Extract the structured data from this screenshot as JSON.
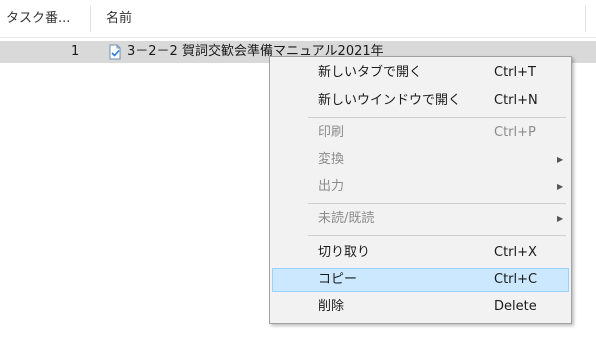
{
  "header": {
    "col_task_number": "タスク番...",
    "col_name": "名前"
  },
  "rows": [
    {
      "task_number": "1",
      "name": "3－2－2 賀詞交歓会準備マニュアル2021年"
    }
  ],
  "context_menu": {
    "items": [
      {
        "label": "新しいタブで開く",
        "shortcut": "Ctrl+T"
      },
      {
        "label": "新しいウインドウで開く",
        "shortcut": "Ctrl+N"
      },
      {
        "label": "印刷",
        "shortcut": "Ctrl+P"
      },
      {
        "label": "変換"
      },
      {
        "label": "出力"
      },
      {
        "label": "未読/既読"
      },
      {
        "label": "切り取り",
        "shortcut": "Ctrl+X"
      },
      {
        "label": "コピー",
        "shortcut": "Ctrl+C"
      },
      {
        "label": "削除",
        "shortcut": "Delete"
      }
    ],
    "highlighted": "コピー"
  },
  "icons": {
    "document": "document-icon",
    "submenu_arrow": "submenu-arrow-icon"
  },
  "colors": {
    "row_selected_bg": "#d9d9d9",
    "menu_bg": "#f2f2f2",
    "menu_highlight_bg": "#cce8ff",
    "menu_highlight_border": "#99d1ff",
    "disabled_text": "#8c8c8c"
  }
}
